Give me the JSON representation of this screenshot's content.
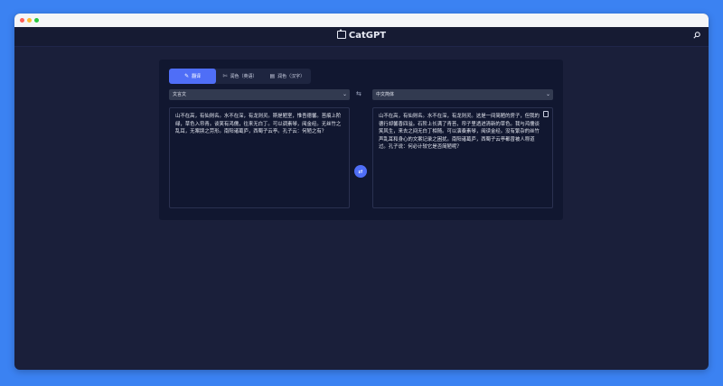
{
  "header": {
    "brand": "CatGPT",
    "icons": {
      "brand": "cat-icon",
      "search": "search-icon"
    }
  },
  "tabs": [
    {
      "label": "翻译",
      "icon": "translate-icon",
      "active": true
    },
    {
      "label": "润色（英语）",
      "icon": "polish-icon",
      "active": false
    },
    {
      "label": "润色（汉字）",
      "icon": "document-icon",
      "active": false
    }
  ],
  "source": {
    "language": "文言文",
    "text": "山不在高，有仙则名。水不在深，有龙则灵。斯是陋室，惟吾德馨。苔痕上阶绿，草色入帘青。谈笑有鸿儒，往来无白丁。可以调素琴，阅金经。无丝竹之乱耳，无案牍之劳形。南阳诸葛庐，西蜀子云亭。孔子云：何陋之有？"
  },
  "target": {
    "language": "中文简体",
    "text": "山不在高，有仙则名。水不在深，有龙则灵。这是一间简陋的房子，但我的德行却馨香四溢。石阶上长满了青苔，帘子里透进清新的草色。我与鸿儒谈笑风生，来去之间无白丁相随。可以演奏素琴，阅读金经。没有繁杂的丝竹声乱耳和身心的文案记录之困扰。南阳诸葛庐，西蜀子云亭都曾被人称道过。孔子说：何必计较它是否简陋呢？"
  },
  "colors": {
    "accent": "#4f6ef7",
    "background": "#3b82f2",
    "window": "#1a1f3a",
    "panel": "#111730"
  }
}
